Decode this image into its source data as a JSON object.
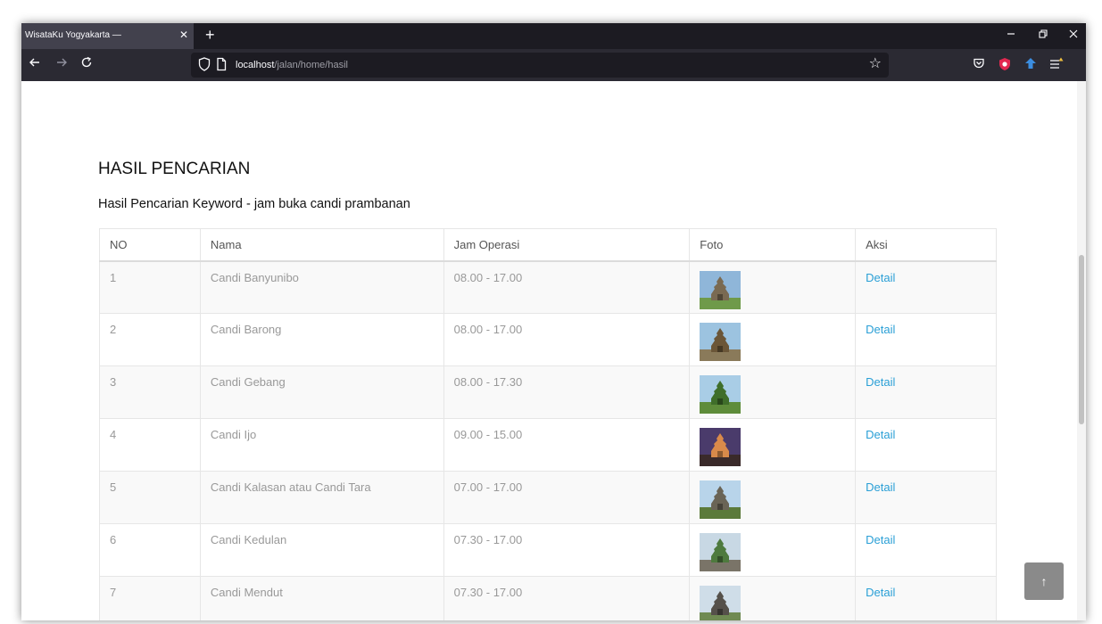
{
  "browser": {
    "tab_title": "WisataKu Yogyakarta —",
    "tab_close": "✕",
    "new_tab": "+",
    "url_host": "localhost",
    "url_path": "/jalan/home/hasil",
    "star": "☆"
  },
  "page": {
    "title": "HASIL PENCARIAN",
    "subtitle": "Hasil Pencarian Keyword - jam buka candi prambanan",
    "back_to_top": "↑"
  },
  "table": {
    "headers": [
      "NO",
      "Nama",
      "Jam Operasi",
      "Foto",
      "Aksi"
    ],
    "rows": [
      {
        "no": "1",
        "nama": "Candi Banyunibo",
        "jam": "08.00 - 17.00",
        "aksi": "Detail",
        "thumb_colors": [
          "#8fb6d9",
          "#7a6a52",
          "#6f9a4a"
        ]
      },
      {
        "no": "2",
        "nama": "Candi Barong",
        "jam": "08.00 - 17.00",
        "aksi": "Detail",
        "thumb_colors": [
          "#9cc3e0",
          "#6b5638",
          "#8a7a5a"
        ]
      },
      {
        "no": "3",
        "nama": "Candi Gebang",
        "jam": "08.00 - 17.30",
        "aksi": "Detail",
        "thumb_colors": [
          "#a9cde6",
          "#3f6e2a",
          "#5e8c3a"
        ]
      },
      {
        "no": "4",
        "nama": "Candi Ijo",
        "jam": "09.00 - 15.00",
        "aksi": "Detail",
        "thumb_colors": [
          "#4a3b6b",
          "#d98a4a",
          "#3a2a2a"
        ]
      },
      {
        "no": "5",
        "nama": "Candi Kalasan atau Candi Tara",
        "jam": "07.00 - 17.00",
        "aksi": "Detail",
        "thumb_colors": [
          "#b8d4ea",
          "#6a6456",
          "#5b7a3a"
        ]
      },
      {
        "no": "6",
        "nama": "Candi Kedulan",
        "jam": "07.30 - 17.00",
        "aksi": "Detail",
        "thumb_colors": [
          "#c8d8e4",
          "#4e7a3e",
          "#7a7468"
        ]
      },
      {
        "no": "7",
        "nama": "Candi Mendut",
        "jam": "07.30 - 17.00",
        "aksi": "Detail",
        "thumb_colors": [
          "#cfdde8",
          "#55504a",
          "#6f8a52"
        ]
      }
    ]
  },
  "colors": {
    "tab_strip": "#1c1b22",
    "toolbar": "#2b2a33",
    "link": "#2a9fd6"
  }
}
